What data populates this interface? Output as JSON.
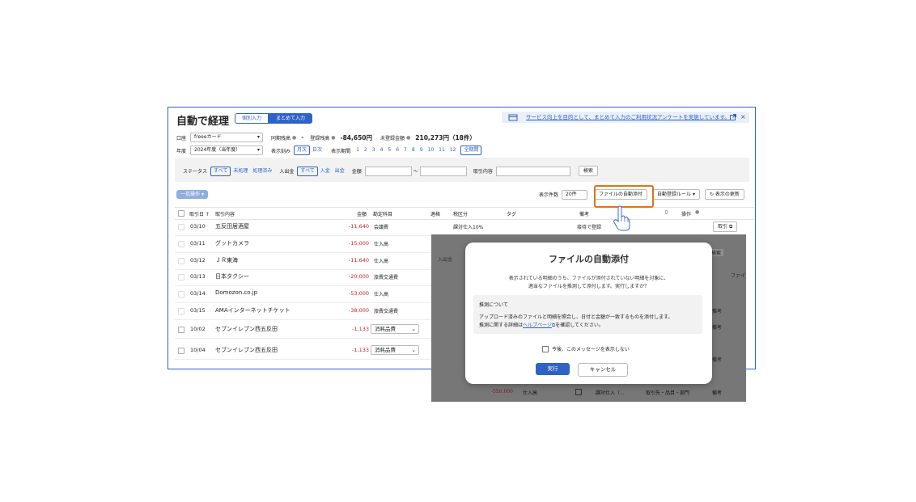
{
  "header": {
    "title": "自動で経理",
    "tab_single": "個別入力",
    "tab_bulk": "まとめて入力",
    "survey_text": "サービス向上を目的として、まとめて入力のご利用状況アンケートを実施しています。"
  },
  "account_row": {
    "account_label": "口座",
    "account_value": "freeeカード",
    "sync_label": "同期残高",
    "sync_value": "-",
    "book_label": "登録残高",
    "book_value": "-84,650円",
    "unreg_label": "未登録金額",
    "unreg_value": "210,273円（18件）"
  },
  "period_row": {
    "year_label": "年度",
    "year_value": "2024年度（当年度）",
    "unit_label": "表示刻み",
    "unit_month": "月次",
    "unit_day": "日次",
    "period_label": "表示期間",
    "months": [
      "1",
      "2",
      "3",
      "4",
      "5",
      "6",
      "7",
      "8",
      "9",
      "10",
      "11",
      "12"
    ],
    "all_period": "全期間"
  },
  "filters": {
    "status_label": "ステータス",
    "status_options": [
      "すべて",
      "未処理",
      "処理済み"
    ],
    "inout_label": "入出金",
    "inout_options": [
      "すべて",
      "入金",
      "出金"
    ],
    "amount_label": "金額",
    "range_sep": "〜",
    "desc_label": "取引内容",
    "search_button": "検索"
  },
  "toolbar": {
    "bulk_button": "一括操作",
    "per_page_label": "表示件数",
    "per_page_value": "20件",
    "auto_attach_button": "ファイルの自動添付",
    "rules_button": "自動登録ルール",
    "refresh_button": "表示の更新"
  },
  "table": {
    "headers": {
      "date": "取引日",
      "desc": "取引内容",
      "amount": "金額",
      "account": "勘定科目",
      "match": "適格",
      "tax": "税区分",
      "tag": "タグ",
      "memo": "備考",
      "action": "操作"
    },
    "rows": [
      {
        "date": "03/10",
        "desc": "五反田居酒屋",
        "amount": "-11,640",
        "account": "会議費",
        "tax": "課対仕入10%",
        "memo": "接待で登録"
      },
      {
        "date": "03/11",
        "desc": "グットカメラ",
        "amount": "-15,000",
        "account": "仕入高",
        "tax": "",
        "memo": ""
      },
      {
        "date": "03/12",
        "desc": "ＪＲ東海",
        "amount": "-11,640",
        "account": "仕入高",
        "tax": "",
        "memo": ""
      },
      {
        "date": "03/13",
        "desc": "日本タクシー",
        "amount": "-20,000",
        "account": "旅費交通費",
        "tax": "",
        "memo": ""
      },
      {
        "date": "03/14",
        "desc": "Domozon.co.jp",
        "amount": "-53,000",
        "account": "仕入高",
        "tax": "",
        "memo": ""
      },
      {
        "date": "03/15",
        "desc": "AMAインターネットチケット",
        "amount": "-38,000",
        "account": "旅費交通費",
        "tax": "",
        "memo": ""
      },
      {
        "date": "10/02",
        "desc": "セブンイレブン西五反田",
        "amount": "-1,133",
        "account": "消耗品費",
        "tax": "",
        "memo": ""
      },
      {
        "date": "10/04",
        "desc": "セブンイレブン西五反田",
        "amount": "-1,133",
        "account": "消耗品費",
        "tax": "",
        "memo": ""
      }
    ],
    "row_action": "取引"
  },
  "dialog": {
    "title": "ファイルの自動添付",
    "message_1": "表示されている明細のうち、ファイルが添付されていない明細を対象に、",
    "message_2": "適当なファイルを推測して添付します。実行しますか？",
    "note_title": "推測について",
    "note_line1": "アップロード済みのファイルと明細を照合し、日付と金額が一致するものを添付します。",
    "note_line2_a": "推測に関する詳細は",
    "note_link": "ヘルプページ",
    "note_line2_b": "を確認してください。",
    "checkbox_label": "今後、このメッセージを表示しない",
    "run_button": "実行",
    "cancel_button": "キャンセル"
  },
  "background_peek": {
    "amount": "-550,000",
    "account": "仕入高",
    "tax": "課対仕入（...",
    "partner": "取引先・品目・部門",
    "memo": "備考",
    "search": "検索",
    "file": "ファイ"
  },
  "colors": {
    "accent": "#2f62c7",
    "negative": "#d42020",
    "highlight": "#e07416"
  }
}
